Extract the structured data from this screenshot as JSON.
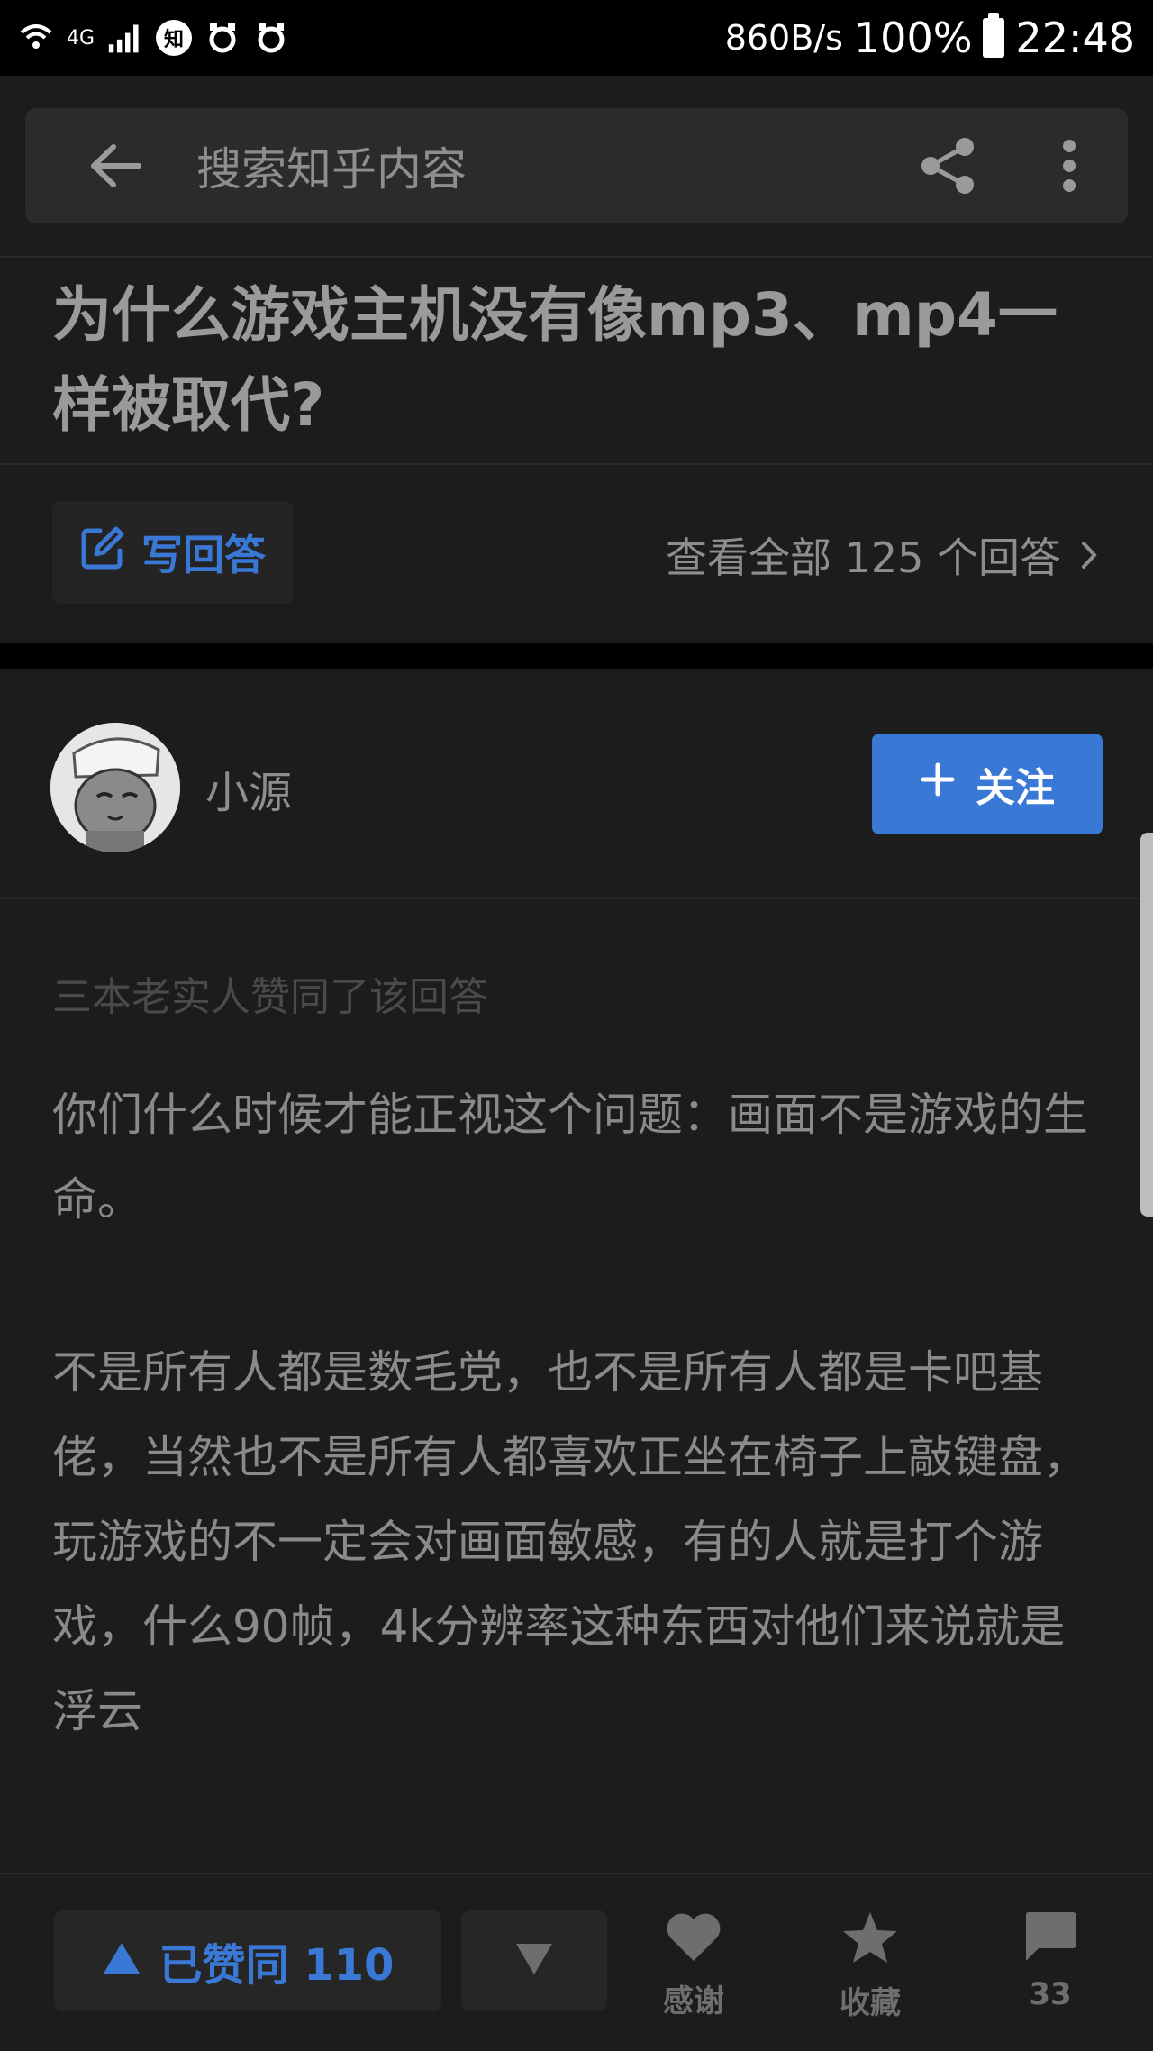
{
  "status_bar": {
    "network": "4G",
    "zhi_badge": "知",
    "speed": "860B/s",
    "battery": "100%",
    "time": "22:48"
  },
  "app_bar": {
    "search_placeholder": "搜索知乎内容"
  },
  "question": {
    "title": "为什么游戏主机没有像mp3、mp4一样被取代?",
    "write_answer_label": "写回答",
    "view_all_label": "查看全部 125 个回答"
  },
  "author": {
    "name": "小源",
    "follow_label": "关注"
  },
  "answer": {
    "endorse_note": "三本老实人赞同了该回答",
    "paragraphs": [
      "你们什么时候才能正视这个问题：画面不是游戏的生命。",
      "不是所有人都是数毛党，也不是所有人都是卡吧基佬，当然也不是所有人都喜欢正坐在椅子上敲键盘，玩游戏的不一定会对画面敏感，有的人就是打个游戏，什么90帧，4k分辨率这种东西对他们来说就是浮云"
    ]
  },
  "bottom_bar": {
    "vote_up_label": "已赞同 110",
    "thanks_label": "感谢",
    "collect_label": "收藏",
    "comments_count": "33"
  },
  "colors": {
    "accent": "#3a78d6",
    "background": "#1c1c1c",
    "status_bar": "#000000"
  }
}
